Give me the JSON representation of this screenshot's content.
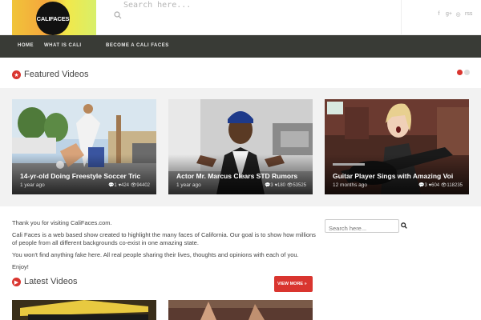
{
  "header": {
    "logo_text": "CALIFACES",
    "search_placeholder": "Search here...",
    "socials": [
      "f",
      "g+",
      "◎",
      "rss"
    ]
  },
  "nav": {
    "items": [
      "HOME",
      "WHAT IS CALI",
      "BECOME A CALI FACES"
    ]
  },
  "featured": {
    "title": "Featured Videos",
    "cards": [
      {
        "title": "14-yr-old Doing Freestyle Soccer Tric",
        "age": "1 year ago",
        "comments": "1",
        "likes": "424",
        "views": "94402"
      },
      {
        "title": "Actor Mr. Marcus Clears STD Rumors",
        "age": "1 year ago",
        "comments": "3",
        "likes": "180",
        "views": "53525"
      },
      {
        "title": "Guitar Player Sings with Amazing Voi",
        "age": "12 months ago",
        "comments": "3",
        "likes": "604",
        "views": "118235"
      }
    ]
  },
  "content": {
    "paragraphs": [
      "Thank you for visiting CaliFaces.com.",
      "Cali Faces is a web based show created to highlight the many faces of California. Our goal is to show how millions of people from all different backgrounds co-exist in one amazing state.",
      "You won't find anything fake here. All real people sharing their lives, thoughts and opinions with each of you.",
      "Enjoy!"
    ]
  },
  "sidebar": {
    "search_placeholder": "Search here..."
  },
  "latest": {
    "title": "Latest Videos",
    "view_more": "VIEW MORE »"
  },
  "colors": {
    "accent": "#d9352f",
    "nav_bg": "#393b36",
    "featured_bg": "#f2f2f2"
  }
}
